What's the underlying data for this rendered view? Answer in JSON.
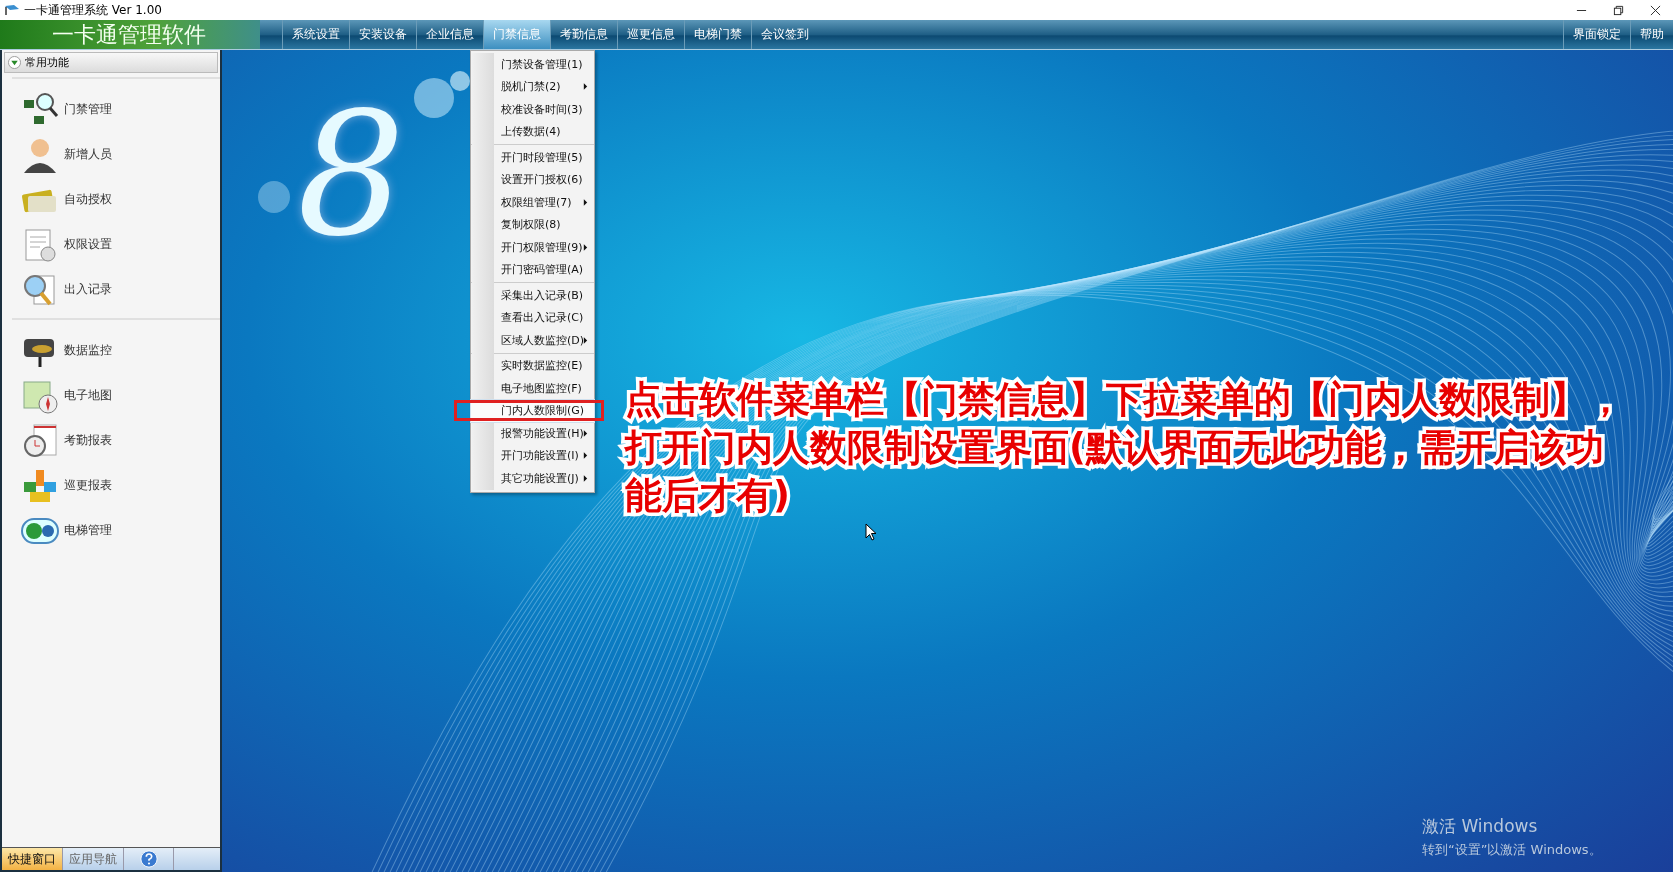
{
  "window": {
    "title": "一卡通管理系统  Ver 1.00"
  },
  "app_title": "一卡通管理软件",
  "menubar": {
    "items": [
      {
        "label": "系统设置",
        "selected": false
      },
      {
        "label": "安装设备",
        "selected": false
      },
      {
        "label": "企业信息",
        "selected": false
      },
      {
        "label": "门禁信息",
        "selected": true
      },
      {
        "label": "考勤信息",
        "selected": false
      },
      {
        "label": "巡更信息",
        "selected": false
      },
      {
        "label": "电梯门禁",
        "selected": false
      },
      {
        "label": "会议签到",
        "selected": false
      }
    ],
    "right_items": [
      "界面锁定",
      "帮助"
    ]
  },
  "sidebar": {
    "header": {
      "label": "常用功能",
      "expanded": true
    },
    "groups": [
      {
        "items": [
          "门禁管理",
          "新增人员",
          "自动授权",
          "权限设置",
          "出入记录"
        ]
      },
      {
        "items": [
          "数据监控",
          "电子地图",
          "考勤报表",
          "巡更报表",
          "电梯管理"
        ]
      }
    ],
    "bottom_tabs": [
      {
        "label": "快捷窗口",
        "selected": true
      },
      {
        "label": "应用导航",
        "selected": false
      }
    ]
  },
  "logo_mark": "8",
  "dropdown_menu": {
    "groups": [
      {
        "items": [
          {
            "label": "门禁设备管理(1)",
            "submenu": false,
            "selected": false
          },
          {
            "label": "脱机门禁(2)",
            "submenu": true,
            "selected": false
          },
          {
            "label": "校准设备时间(3)",
            "submenu": false,
            "selected": false
          },
          {
            "label": "上传数据(4)",
            "submenu": false,
            "selected": false
          }
        ]
      },
      {
        "items": [
          {
            "label": "开门时段管理(5)",
            "submenu": false,
            "selected": false
          },
          {
            "label": "设置开门授权(6)",
            "submenu": false,
            "selected": false
          },
          {
            "label": "权限组管理(7)",
            "submenu": true,
            "selected": false
          },
          {
            "label": "复制权限(8)",
            "submenu": false,
            "selected": false
          },
          {
            "label": "开门权限管理(9)",
            "submenu": true,
            "selected": false
          },
          {
            "label": "开门密码管理(A)",
            "submenu": false,
            "selected": false
          }
        ]
      },
      {
        "items": [
          {
            "label": "采集出入记录(B)",
            "submenu": false,
            "selected": false
          },
          {
            "label": "查看出入记录(C)",
            "submenu": false,
            "selected": false
          },
          {
            "label": "区域人数监控(D)",
            "submenu": true,
            "selected": false
          }
        ]
      },
      {
        "items": [
          {
            "label": "实时数据监控(E)",
            "submenu": false,
            "selected": false
          },
          {
            "label": "电子地图监控(F)",
            "submenu": false,
            "selected": false
          },
          {
            "label": "门内人数限制(G)",
            "submenu": false,
            "selected": true
          },
          {
            "label": "报警功能设置(H)",
            "submenu": true,
            "selected": false
          },
          {
            "label": "开门功能设置(I)",
            "submenu": true,
            "selected": false
          },
          {
            "label": "其它功能设置(J)",
            "submenu": true,
            "selected": false
          }
        ]
      }
    ]
  },
  "annotation": "点击软件菜单栏【门禁信息】下拉菜单的【门内人数限制】，打开门内人数限制设置界面(默认界面无此功能，需开启该功能后才有)",
  "activation_notice": {
    "title": "激活 Windows",
    "subtitle": "转到“设置”以激活 Windows。"
  }
}
